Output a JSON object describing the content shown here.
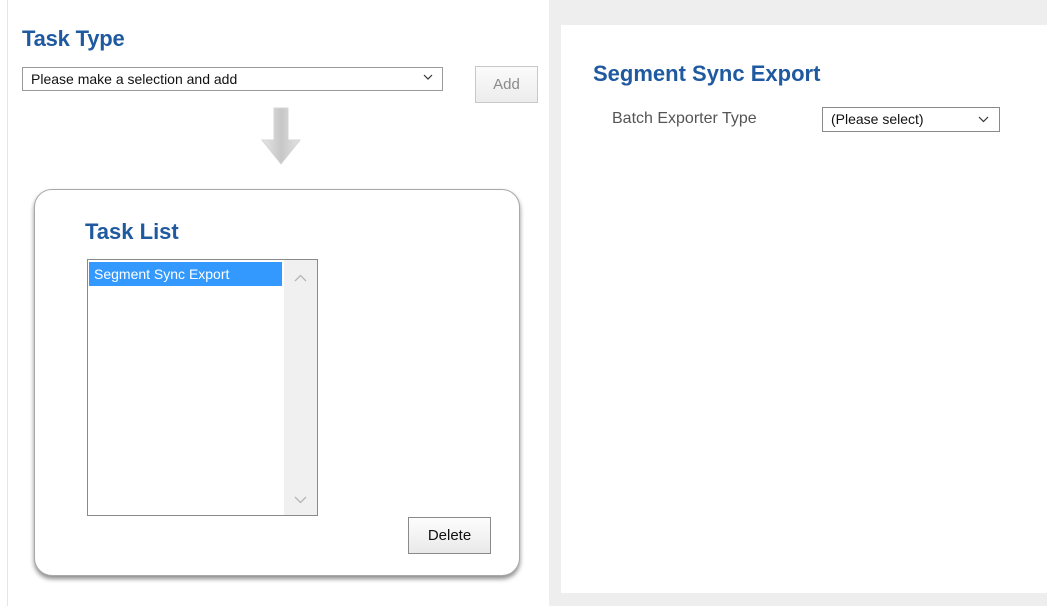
{
  "task_type": {
    "title": "Task Type",
    "select_value": "Please make a selection and add",
    "add_label": "Add"
  },
  "task_list": {
    "title": "Task List",
    "items": [
      {
        "label": "Segment Sync Export",
        "selected": true
      }
    ],
    "delete_label": "Delete"
  },
  "detail": {
    "title": "Segment Sync Export",
    "batch_exporter_label": "Batch Exporter Type",
    "batch_exporter_value": "(Please select)"
  },
  "colors": {
    "heading": "#1f5aa0",
    "selection": "#3399ff",
    "panel_bg": "#eeeeee"
  },
  "icons": [
    "chevron-down-icon",
    "down-arrow-icon",
    "scroll-up-icon",
    "scroll-down-icon"
  ]
}
